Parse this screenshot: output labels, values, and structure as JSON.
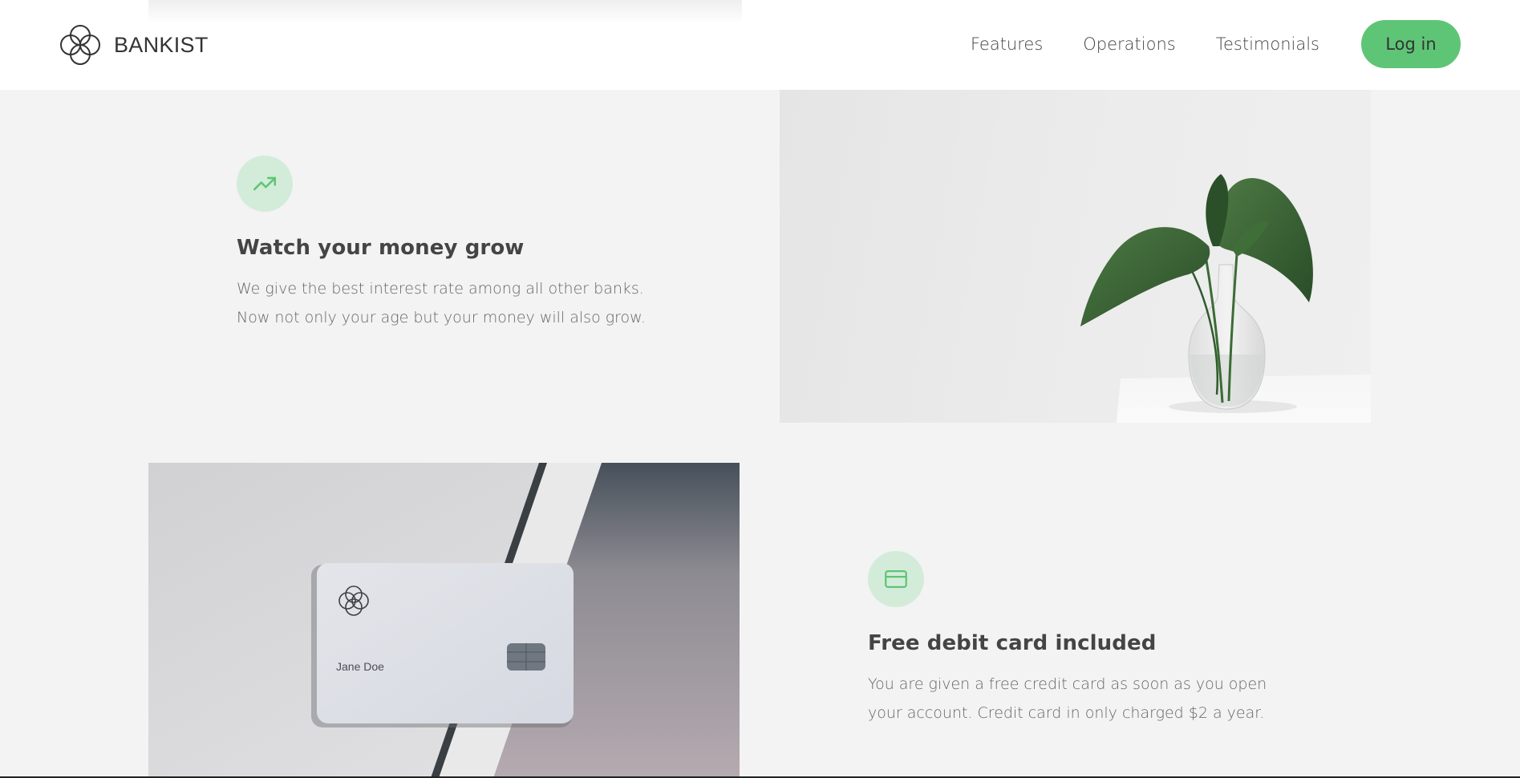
{
  "brand": {
    "name": "BANKIST"
  },
  "nav": {
    "links": [
      "Features",
      "Operations",
      "Testimonials"
    ],
    "login_label": "Log in"
  },
  "features": [
    {
      "icon": "trending-up-icon",
      "title": "Watch your money grow",
      "lines": [
        "We give the best interest rate among all other banks.",
        "Now not only your age but your money will also grow."
      ]
    },
    {
      "icon": "credit-card-icon",
      "title": "Free debit card included",
      "lines": [
        "You are given a free credit card as soon as you open",
        "your account. Credit card in only charged $2 a year."
      ]
    }
  ],
  "card_image": {
    "holder_name": "Jane Doe"
  },
  "colors": {
    "accent": "#5ec576",
    "icon_bg": "#d3ecd9",
    "page_bg": "#f3f3f3"
  }
}
